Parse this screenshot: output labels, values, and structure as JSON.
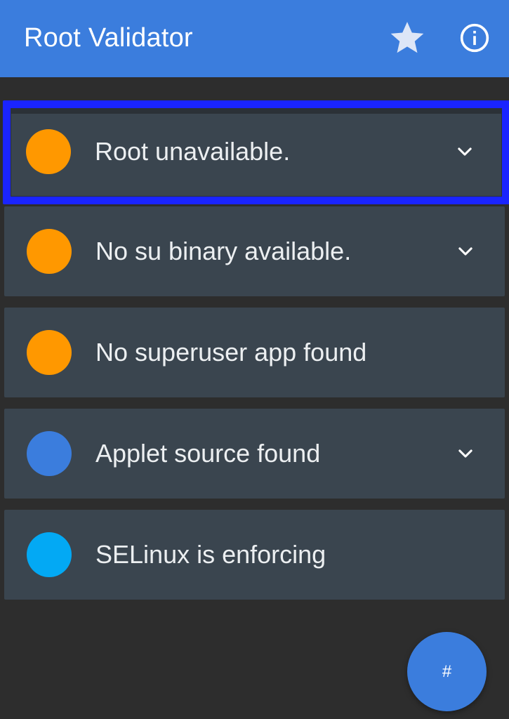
{
  "app_bar": {
    "title": "Root Validator",
    "icons": [
      "star-icon",
      "info-icon"
    ],
    "color": "#3b7ddd"
  },
  "checks": [
    {
      "label": "Root unavailable.",
      "status_color": "#ff9800",
      "expandable": true,
      "selected": true
    },
    {
      "label": "No su binary available.",
      "status_color": "#ff9800",
      "expandable": true,
      "selected": false
    },
    {
      "label": "No superuser app found",
      "status_color": "#ff9800",
      "expandable": false,
      "selected": false
    },
    {
      "label": "Applet source found",
      "status_color": "#3b7ddd",
      "expandable": true,
      "selected": false
    },
    {
      "label": "SELinux is enforcing",
      "status_color": "#03a9f4",
      "expandable": false,
      "selected": false
    }
  ],
  "fab": {
    "label": "#",
    "color": "#3b7ddd"
  }
}
